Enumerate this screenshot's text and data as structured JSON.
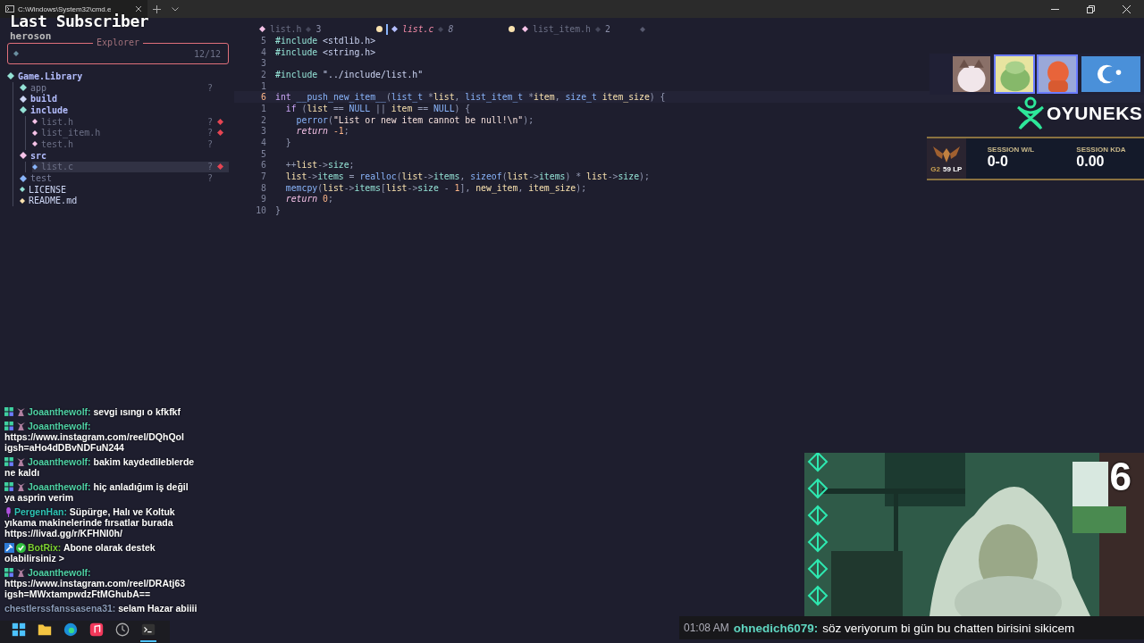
{
  "terminal_tab": {
    "title": "C:\\Windows\\System32\\cmd.e"
  },
  "last_subscriber": {
    "title": "Last Subscriber",
    "name": "heroson"
  },
  "explorer": {
    "title": "Explorer",
    "count": "12/12",
    "tree": [
      {
        "name": "Game.Library",
        "kind": "folder",
        "color": "#94e2d5",
        "dimmed": false,
        "selected": false,
        "modified": false,
        "children": [
          {
            "name": "app",
            "kind": "folder",
            "color": "#94e2d5",
            "dimmed": true,
            "selected": false,
            "modified": false,
            "status": "?"
          },
          {
            "name": "build",
            "kind": "folder",
            "color": "#cdd6f4",
            "dimmed": false,
            "selected": false,
            "modified": false
          },
          {
            "name": "include",
            "kind": "folder",
            "color": "#94e2d5",
            "dimmed": false,
            "selected": false,
            "modified": false,
            "children": [
              {
                "name": "list.h",
                "kind": "file",
                "color": "#f5c2e7",
                "dimmed": true,
                "selected": false,
                "modified": true,
                "status": "?"
              },
              {
                "name": "list_item.h",
                "kind": "file",
                "color": "#f5c2e7",
                "dimmed": true,
                "selected": false,
                "modified": true,
                "status": "?"
              },
              {
                "name": "test.h",
                "kind": "file",
                "color": "#f5c2e7",
                "dimmed": true,
                "selected": false,
                "modified": false,
                "status": "?"
              }
            ]
          },
          {
            "name": "src",
            "kind": "folder",
            "color": "#f5c2e7",
            "dimmed": false,
            "selected": false,
            "modified": false,
            "children": [
              {
                "name": "list.c",
                "kind": "file",
                "color": "#89b4fa",
                "dimmed": true,
                "selected": true,
                "modified": true,
                "status": "?"
              }
            ]
          },
          {
            "name": "test",
            "kind": "folder",
            "color": "#89b4fa",
            "dimmed": true,
            "selected": false,
            "modified": false,
            "status": "?"
          },
          {
            "name": "LICENSE",
            "kind": "file",
            "color": "#94e2d5",
            "dimmed": false,
            "selected": false,
            "modified": false
          },
          {
            "name": "README.md",
            "kind": "file",
            "color": "#f9e2af",
            "dimmed": false,
            "selected": false,
            "modified": false
          }
        ]
      }
    ]
  },
  "editor": {
    "tabs": [
      {
        "label": "list.h",
        "count": "3",
        "selected": false,
        "modified": true
      },
      {
        "label": "list.c",
        "count": "8",
        "selected": true,
        "modified": true
      },
      {
        "label": "list_item.h",
        "count": "2",
        "selected": false,
        "modified": false
      }
    ],
    "lines": [
      {
        "number": "5",
        "current": false,
        "code": [
          {
            "kind": "pre",
            "text": "#include"
          },
          {
            "kind": "plain",
            "text": " <stdlib.h>"
          }
        ]
      },
      {
        "number": "4",
        "current": false,
        "code": [
          {
            "kind": "pre",
            "text": "#include"
          },
          {
            "kind": "plain",
            "text": " <string.h>"
          }
        ]
      },
      {
        "number": "3",
        "current": false
      },
      {
        "number": "2",
        "current": false,
        "code": [
          {
            "kind": "pre",
            "text": "#include"
          },
          {
            "kind": "plain",
            "text": " \"../include/list.h\""
          }
        ]
      },
      {
        "number": "1",
        "current": false
      },
      {
        "number": "6",
        "current": true,
        "code": [
          {
            "kind": "kw",
            "text": "int"
          },
          {
            "kind": "fn",
            "text": " __push_new_item__"
          },
          {
            "kind": "op",
            "text": "("
          },
          {
            "kind": "type",
            "text": "list_t"
          },
          {
            "kind": "op",
            "text": " *"
          },
          {
            "kind": "var",
            "text": "list"
          },
          {
            "kind": "op",
            "text": ", "
          },
          {
            "kind": "type",
            "text": "list_item_t"
          },
          {
            "kind": "op",
            "text": " *"
          },
          {
            "kind": "var",
            "text": "item"
          },
          {
            "kind": "op",
            "text": ", "
          },
          {
            "kind": "type",
            "text": "size_t"
          },
          {
            "kind": "var",
            "text": " item_size"
          },
          {
            "kind": "op",
            "text": ") {"
          }
        ]
      },
      {
        "number": "1",
        "current": false,
        "code": [
          {
            "kind": "kw",
            "text": "  if"
          },
          {
            "kind": "op",
            "text": " ("
          },
          {
            "kind": "var",
            "text": "list"
          },
          {
            "kind": "op",
            "text": " == "
          },
          {
            "kind": "const",
            "text": "NULL"
          },
          {
            "kind": "op",
            "text": " || "
          },
          {
            "kind": "var",
            "text": "item"
          },
          {
            "kind": "op",
            "text": " == "
          },
          {
            "kind": "const",
            "text": "NULL"
          },
          {
            "kind": "op",
            "text": ") {"
          }
        ]
      },
      {
        "number": "2",
        "current": false,
        "code": [
          {
            "kind": "fn",
            "text": "    perror"
          },
          {
            "kind": "op",
            "text": "("
          },
          {
            "kind": "str",
            "text": "\"List or new item cannot be null!\\n\""
          },
          {
            "kind": "op",
            "text": ");"
          }
        ]
      },
      {
        "number": "3",
        "current": false,
        "code": [
          {
            "kind": "ret",
            "text": "    return"
          },
          {
            "kind": "num",
            "text": " -1"
          },
          {
            "kind": "op",
            "text": ";"
          }
        ]
      },
      {
        "number": "4",
        "current": false,
        "code": [
          {
            "kind": "op",
            "text": "  }"
          }
        ]
      },
      {
        "number": "5",
        "current": false
      },
      {
        "number": "6",
        "current": false,
        "code": [
          {
            "kind": "op",
            "text": "  ++"
          },
          {
            "kind": "var",
            "text": "list"
          },
          {
            "kind": "op",
            "text": "->"
          },
          {
            "kind": "field",
            "text": "size"
          },
          {
            "kind": "op",
            "text": ";"
          }
        ]
      },
      {
        "number": "7",
        "current": false,
        "code": [
          {
            "kind": "var",
            "text": "  list"
          },
          {
            "kind": "op",
            "text": "->"
          },
          {
            "kind": "field",
            "text": "items"
          },
          {
            "kind": "op",
            "text": " = "
          },
          {
            "kind": "fn",
            "text": "realloc"
          },
          {
            "kind": "op",
            "text": "("
          },
          {
            "kind": "var",
            "text": "list"
          },
          {
            "kind": "op",
            "text": "->"
          },
          {
            "kind": "field",
            "text": "items"
          },
          {
            "kind": "op",
            "text": ", "
          },
          {
            "kind": "fn",
            "text": "sizeof"
          },
          {
            "kind": "op",
            "text": "("
          },
          {
            "kind": "var",
            "text": "list"
          },
          {
            "kind": "op",
            "text": "->"
          },
          {
            "kind": "field",
            "text": "items"
          },
          {
            "kind": "op",
            "text": ") * "
          },
          {
            "kind": "var",
            "text": "list"
          },
          {
            "kind": "op",
            "text": "->"
          },
          {
            "kind": "field",
            "text": "size"
          },
          {
            "kind": "op",
            "text": ");"
          }
        ]
      },
      {
        "number": "8",
        "current": false,
        "code": [
          {
            "kind": "fn",
            "text": "  memcpy"
          },
          {
            "kind": "op",
            "text": "("
          },
          {
            "kind": "var",
            "text": "list"
          },
          {
            "kind": "op",
            "text": "->"
          },
          {
            "kind": "field",
            "text": "items"
          },
          {
            "kind": "op",
            "text": "["
          },
          {
            "kind": "var",
            "text": "list"
          },
          {
            "kind": "op",
            "text": "->"
          },
          {
            "kind": "field",
            "text": "size"
          },
          {
            "kind": "op",
            "text": " - "
          },
          {
            "kind": "num",
            "text": "1"
          },
          {
            "kind": "op",
            "text": "], "
          },
          {
            "kind": "var",
            "text": "new_item"
          },
          {
            "kind": "op",
            "text": ", "
          },
          {
            "kind": "var",
            "text": "item_size"
          },
          {
            "kind": "op",
            "text": ");"
          }
        ]
      },
      {
        "number": "9",
        "current": false,
        "code": [
          {
            "kind": "ret",
            "text": "  return"
          },
          {
            "kind": "num",
            "text": " 0"
          },
          {
            "kind": "op",
            "text": ";"
          }
        ]
      },
      {
        "number": "10",
        "current": false,
        "code": [
          {
            "kind": "op",
            "text": "}"
          }
        ]
      }
    ]
  },
  "emotes": [
    {
      "kind": "picture",
      "selected": false
    },
    {
      "kind": "picture",
      "selected": true
    },
    {
      "kind": "picture",
      "selected": true
    },
    {
      "kind": "picture",
      "selected": false
    }
  ],
  "brand": {
    "name": "OYUNEKS"
  },
  "rank_panel": {
    "tier": "G2",
    "points": "59 LP",
    "stats": [
      {
        "label": "SESSION W/L",
        "value": "0-0"
      },
      {
        "label": "SESSION KDA",
        "value": "0.00"
      }
    ]
  },
  "chat": [
    {
      "user": "Joaanthewolf:",
      "color": "#4fd1a5",
      "badges": [
        {
          "kind": "grid"
        },
        {
          "kind": "paw"
        }
      ],
      "message": "sevgi ısıngı o kfkfkf"
    },
    {
      "user": "Joaanthewolf:",
      "color": "#4fd1a5",
      "badges": [
        {
          "kind": "grid"
        },
        {
          "kind": "paw"
        }
      ],
      "message": "https://www.instagram.com/reel/DQhQol igsh=aHo4dDBvNDFuN244"
    },
    {
      "user": "Joaanthewolf:",
      "color": "#4fd1a5",
      "badges": [
        {
          "kind": "grid"
        },
        {
          "kind": "paw"
        }
      ],
      "message": "bakim kaydedileblerde ne kaldı"
    },
    {
      "user": "Joaanthewolf:",
      "color": "#4fd1a5",
      "badges": [
        {
          "kind": "grid"
        },
        {
          "kind": "paw"
        }
      ],
      "message": "hiç anladığım iş değil ya asprin verim"
    },
    {
      "user": "PergenHan:",
      "color": "#2ec4b6",
      "badges": [
        {
          "kind": "mic"
        }
      ],
      "message": "Süpürge, Halı ve Koltuk yıkama makinelerinde fırsatlar burada https://livad.gg/r/KFHNI0h/"
    },
    {
      "user": "BotRix:",
      "color": "#7cd132",
      "badges": [
        {
          "kind": "hammer"
        },
        {
          "kind": "verified"
        }
      ],
      "message": "Abone olarak destek olabilirsiniz >"
    },
    {
      "user": "Joaanthewolf:",
      "color": "#4fd1a5",
      "badges": [
        {
          "kind": "grid"
        },
        {
          "kind": "paw"
        }
      ],
      "message": "https://www.instagram.com/reel/DRAtj63 igsh=MWxtampwdzFtMGhubA=="
    },
    {
      "user": "chestlerssfanssasena31:",
      "color": "#8a9bb8",
      "message": "selam Hazar abiiii"
    }
  ],
  "taskbar": [
    {
      "kind": "start",
      "active": false
    },
    {
      "kind": "folder",
      "active": false
    },
    {
      "kind": "browser",
      "active": false
    },
    {
      "kind": "music",
      "active": false
    },
    {
      "kind": "clock",
      "active": false
    },
    {
      "kind": "terminal",
      "active": true
    }
  ],
  "webcam": {
    "kind": "picture",
    "counter": "6"
  },
  "highlight": {
    "time": "01:08 AM",
    "user": "ohnedich6079:",
    "message": "söz veriyorum bi gün bu chatten birisini sikicem"
  }
}
